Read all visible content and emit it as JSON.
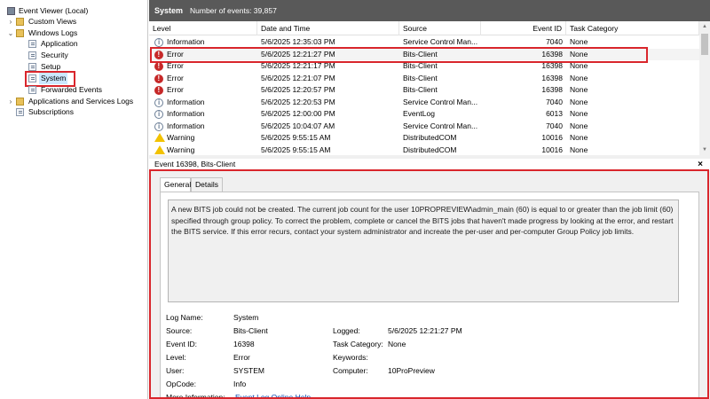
{
  "tree": {
    "root": "Event Viewer (Local)",
    "custom_views": "Custom Views",
    "windows_logs": "Windows Logs",
    "application": "Application",
    "security": "Security",
    "setup": "Setup",
    "system": "System",
    "forwarded_events": "Forwarded Events",
    "apps_services": "Applications and Services Logs",
    "subscriptions": "Subscriptions"
  },
  "header": {
    "title": "System",
    "count": "Number of events: 39,857"
  },
  "columns": [
    "Level",
    "Date and Time",
    "Source",
    "Event ID",
    "Task Category"
  ],
  "events": [
    {
      "level": "Information",
      "icon": "information-icon",
      "datetime": "5/6/2025 12:35:03 PM",
      "source": "Service Control Man...",
      "id": "7040",
      "category": "None"
    },
    {
      "level": "Error",
      "icon": "error-icon",
      "datetime": "5/6/2025 12:21:27 PM",
      "source": "Bits-Client",
      "id": "16398",
      "category": "None"
    },
    {
      "level": "Error",
      "icon": "error-icon",
      "datetime": "5/6/2025 12:21:17 PM",
      "source": "Bits-Client",
      "id": "16398",
      "category": "None"
    },
    {
      "level": "Error",
      "icon": "error-icon",
      "datetime": "5/6/2025 12:21:07 PM",
      "source": "Bits-Client",
      "id": "16398",
      "category": "None"
    },
    {
      "level": "Error",
      "icon": "error-icon",
      "datetime": "5/6/2025 12:20:57 PM",
      "source": "Bits-Client",
      "id": "16398",
      "category": "None"
    },
    {
      "level": "Information",
      "icon": "information-icon",
      "datetime": "5/6/2025 12:20:53 PM",
      "source": "Service Control Man...",
      "id": "7040",
      "category": "None"
    },
    {
      "level": "Information",
      "icon": "information-icon",
      "datetime": "5/6/2025 12:00:00 PM",
      "source": "EventLog",
      "id": "6013",
      "category": "None"
    },
    {
      "level": "Information",
      "icon": "information-icon",
      "datetime": "5/6/2025 10:04:07 AM",
      "source": "Service Control Man...",
      "id": "7040",
      "category": "None"
    },
    {
      "level": "Warning",
      "icon": "warning-icon",
      "datetime": "5/6/2025 9:55:15 AM",
      "source": "DistributedCOM",
      "id": "10016",
      "category": "None"
    },
    {
      "level": "Warning",
      "icon": "warning-icon",
      "datetime": "5/6/2025 9:55:15 AM",
      "source": "DistributedCOM",
      "id": "10016",
      "category": "None"
    }
  ],
  "detail": {
    "header": "Event 16398, Bits-Client",
    "close": "×",
    "tabs": [
      "General",
      "Details"
    ],
    "message": "A new BITS job could not be created. The current job count for the user 10PROPREVIEW\\admin_main (60) is equal to or greater than the job limit (60) specified through group policy.  To correct the problem, complete or cancel the BITS jobs that haven't made progress by looking at the error, and restart the BITS service. If this error recurs, contact your system administrator and increate the per-user and per-computer Group Policy job limits.",
    "labels": {
      "log_name": "Log Name:",
      "source": "Source:",
      "event_id": "Event ID:",
      "level": "Level:",
      "user": "User:",
      "opcode": "OpCode:",
      "more_info": "More Information:",
      "logged": "Logged:",
      "task_category": "Task Category:",
      "keywords": "Keywords:",
      "computer": "Computer:"
    },
    "values": {
      "log_name": "System",
      "source": "Bits-Client",
      "event_id": "16398",
      "level": "Error",
      "user": "SYSTEM",
      "opcode": "Info",
      "more_info": "Event Log Online Help",
      "logged": "5/6/2025 12:21:27 PM",
      "task_category": "None",
      "keywords": "",
      "computer": "10ProPreview"
    }
  },
  "colors": {
    "header_bg": "#595959",
    "highlight_box": "#d9262c",
    "selection": "#cce8ff",
    "link": "#0645ad"
  }
}
